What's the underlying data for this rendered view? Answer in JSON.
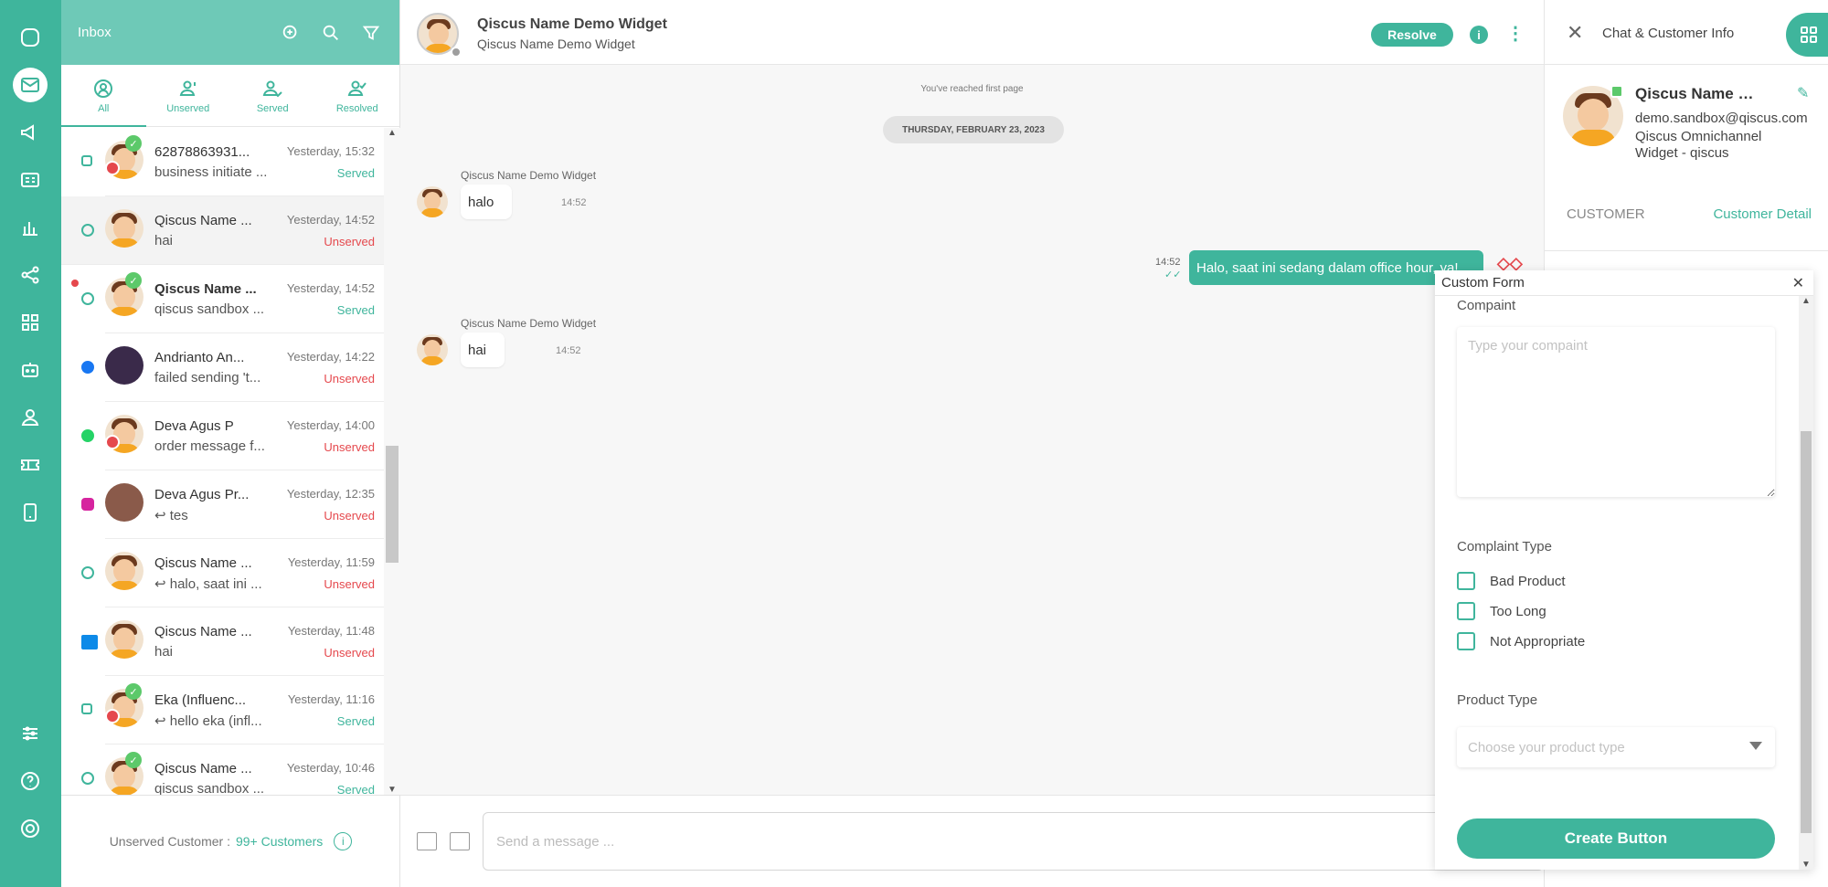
{
  "inbox": {
    "title": "Inbox",
    "tabs": [
      {
        "label": "All"
      },
      {
        "label": "Unserved"
      },
      {
        "label": "Served"
      },
      {
        "label": "Resolved"
      }
    ],
    "rooms": [
      {
        "name": "62878863931...",
        "preview": "business initiate ...",
        "time": "Yesterday, 15:32",
        "status": "Served"
      },
      {
        "name": "Qiscus Name ...",
        "preview": "hai",
        "time": "Yesterday, 14:52",
        "status": "Unserved"
      },
      {
        "name": "Qiscus Name ...",
        "preview": "qiscus sandbox ...",
        "time": "Yesterday, 14:52",
        "status": "Served"
      },
      {
        "name": "Andrianto An...",
        "preview": "failed sending 't...",
        "time": "Yesterday, 14:22",
        "status": "Unserved"
      },
      {
        "name": "Deva Agus P",
        "preview": "order message f...",
        "time": "Yesterday, 14:00",
        "status": "Unserved"
      },
      {
        "name": "Deva Agus Pr...",
        "preview": "tes",
        "time": "Yesterday, 12:35",
        "status": "Unserved"
      },
      {
        "name": "Qiscus Name ...",
        "preview": "halo, saat ini ...",
        "time": "Yesterday, 11:59",
        "status": "Unserved"
      },
      {
        "name": "Qiscus Name ...",
        "preview": "hai",
        "time": "Yesterday, 11:48",
        "status": "Unserved"
      },
      {
        "name": "Eka (Influenc...",
        "preview": "hello eka (infl...",
        "time": "Yesterday, 11:16",
        "status": "Served"
      },
      {
        "name": "Qiscus Name ...",
        "preview": "qiscus sandbox ...",
        "time": "Yesterday, 10:46",
        "status": "Served"
      }
    ],
    "footer": {
      "label": "Unserved Customer :",
      "count": "99+ Customers",
      "info": "i"
    }
  },
  "chat": {
    "title": "Qiscus Name Demo Widget",
    "subtitle": "Qiscus Name Demo Widget",
    "resolve_label": "Resolve",
    "info_label": "i",
    "more_label": "⋮",
    "first_page": "You've reached first page",
    "date": "THURSDAY, FEBRUARY 23, 2023",
    "messages": [
      {
        "sender": "Qiscus Name Demo Widget",
        "text": "halo",
        "time": "14:52"
      },
      {
        "text": "Halo, saat ini sedang dalam office hour, ya!",
        "time": "14:52"
      },
      {
        "sender": "Qiscus Name Demo Widget",
        "text": "hai",
        "time": "14:52"
      }
    ],
    "composer_placeholder": "Send a message ..."
  },
  "info_panel": {
    "title": "Chat & Customer Info",
    "customer_name": "Qiscus Name Demo Widget",
    "email": "demo.sandbox@qiscus.com",
    "channel": "Qiscus Omnichannel Widget - qiscus",
    "tabs": [
      "CUSTOMER",
      "Customer Detail"
    ]
  },
  "custom_form": {
    "title": "Custom Form",
    "complaint_label": "Compaint",
    "complaint_placeholder": "Type your compaint",
    "complaint_type_label": "Complaint Type",
    "options": [
      "Bad Product",
      "Too Long",
      "Not Appropriate"
    ],
    "product_type_label": "Product Type",
    "product_type_placeholder": "Choose your product type",
    "create_label": "Create Button"
  },
  "colors": {
    "accent": "#3fb59c",
    "served": "#3fb59c",
    "unserved": "#e5484d"
  }
}
